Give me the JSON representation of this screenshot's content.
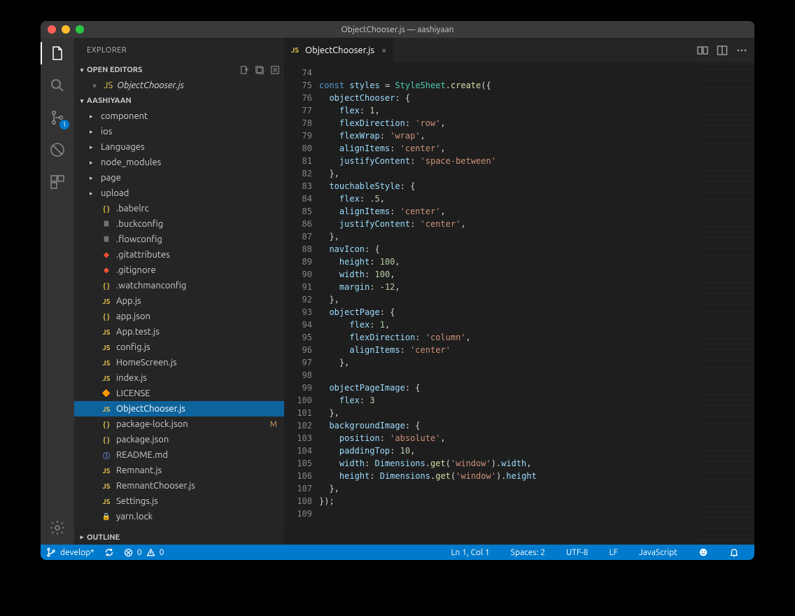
{
  "window": {
    "title": "ObjectChooser.js — aashiyaan"
  },
  "explorer": {
    "title": "EXPLORER",
    "openEditorsLabel": "OPEN EDITORS",
    "projectLabel": "AASHIYAAN",
    "outlineLabel": "OUTLINE",
    "openEditor": {
      "name": "ObjectChooser.js"
    },
    "scmBadge": "1",
    "tree": [
      {
        "name": "component",
        "kind": "folder"
      },
      {
        "name": "ios",
        "kind": "folder"
      },
      {
        "name": "Languages",
        "kind": "folder"
      },
      {
        "name": "node_modules",
        "kind": "folder"
      },
      {
        "name": "page",
        "kind": "folder"
      },
      {
        "name": "upload",
        "kind": "folder"
      },
      {
        "name": ".babelrc",
        "kind": "file",
        "icon": "json"
      },
      {
        "name": ".buckconfig",
        "kind": "file",
        "icon": "text"
      },
      {
        "name": ".flowconfig",
        "kind": "file",
        "icon": "text"
      },
      {
        "name": ".gitattributes",
        "kind": "file",
        "icon": "git"
      },
      {
        "name": ".gitignore",
        "kind": "file",
        "icon": "git"
      },
      {
        "name": ".watchmanconfig",
        "kind": "file",
        "icon": "json"
      },
      {
        "name": "App.js",
        "kind": "file",
        "icon": "js"
      },
      {
        "name": "app.json",
        "kind": "file",
        "icon": "json"
      },
      {
        "name": "App.test.js",
        "kind": "file",
        "icon": "js"
      },
      {
        "name": "config.js",
        "kind": "file",
        "icon": "js"
      },
      {
        "name": "HomeScreen.js",
        "kind": "file",
        "icon": "js"
      },
      {
        "name": "index.js",
        "kind": "file",
        "icon": "js"
      },
      {
        "name": "LICENSE",
        "kind": "file",
        "icon": "lic"
      },
      {
        "name": "ObjectChooser.js",
        "kind": "file",
        "icon": "js",
        "selected": true
      },
      {
        "name": "package-lock.json",
        "kind": "file",
        "icon": "json",
        "status": "M"
      },
      {
        "name": "package.json",
        "kind": "file",
        "icon": "json"
      },
      {
        "name": "README.md",
        "kind": "file",
        "icon": "info"
      },
      {
        "name": "Remnant.js",
        "kind": "file",
        "icon": "js"
      },
      {
        "name": "RemnantChooser.js",
        "kind": "file",
        "icon": "js"
      },
      {
        "name": "Settings.js",
        "kind": "file",
        "icon": "js"
      },
      {
        "name": "yarn.lock",
        "kind": "file",
        "icon": "lock"
      }
    ]
  },
  "tab": {
    "name": "ObjectChooser.js"
  },
  "code": {
    "startLine": 74,
    "lines": [
      {
        "n": 74,
        "html": ""
      },
      {
        "n": 75,
        "html": "<span class='kw'>const</span> <span class='id'>styles</span> <span class='op'>=</span> <span class='fn'>StyleSheet</span><span class='pn'>.</span><span class='mt'>create</span><span class='pn'>({</span>"
      },
      {
        "n": 76,
        "html": "  <span class='id'>objectChooser</span><span class='pn'>:</span> <span class='pn'>{</span>"
      },
      {
        "n": 77,
        "html": "    <span class='id'>flex</span><span class='pn'>:</span> <span class='nu'>1</span><span class='pn'>,</span>"
      },
      {
        "n": 78,
        "html": "    <span class='id'>flexDirection</span><span class='pn'>:</span> <span class='st'>'row'</span><span class='pn'>,</span>"
      },
      {
        "n": 79,
        "html": "    <span class='id'>flexWrap</span><span class='pn'>:</span> <span class='st'>'wrap'</span><span class='pn'>,</span>"
      },
      {
        "n": 80,
        "html": "    <span class='id'>alignItems</span><span class='pn'>:</span> <span class='st'>'center'</span><span class='pn'>,</span>"
      },
      {
        "n": 81,
        "html": "    <span class='id'>justifyContent</span><span class='pn'>:</span> <span class='st'>'space-between'</span>"
      },
      {
        "n": 82,
        "html": "  <span class='pn'>},</span>"
      },
      {
        "n": 83,
        "html": "  <span class='id'>touchableStyle</span><span class='pn'>:</span> <span class='pn'>{</span>"
      },
      {
        "n": 84,
        "html": "    <span class='id'>flex</span><span class='pn'>:</span> <span class='nu'>.5</span><span class='pn'>,</span>"
      },
      {
        "n": 85,
        "html": "    <span class='id'>alignItems</span><span class='pn'>:</span> <span class='st'>'center'</span><span class='pn'>,</span>"
      },
      {
        "n": 86,
        "html": "    <span class='id'>justifyContent</span><span class='pn'>:</span> <span class='st'>'center'</span><span class='pn'>,</span>"
      },
      {
        "n": 87,
        "html": "  <span class='pn'>},</span>"
      },
      {
        "n": 88,
        "html": "  <span class='id'>navIcon</span><span class='pn'>:</span> <span class='pn'>{</span>"
      },
      {
        "n": 89,
        "html": "    <span class='id'>height</span><span class='pn'>:</span> <span class='nu'>100</span><span class='pn'>,</span>"
      },
      {
        "n": 90,
        "html": "    <span class='id'>width</span><span class='pn'>:</span> <span class='nu'>100</span><span class='pn'>,</span>"
      },
      {
        "n": 91,
        "html": "    <span class='id'>margin</span><span class='pn'>:</span> <span class='nu'>-12</span><span class='pn'>,</span>"
      },
      {
        "n": 92,
        "html": "  <span class='pn'>},</span>"
      },
      {
        "n": 93,
        "html": "  <span class='id'>objectPage</span><span class='pn'>:</span> <span class='pn'>{</span>"
      },
      {
        "n": 94,
        "html": "      <span class='id'>flex</span><span class='pn'>:</span> <span class='nu'>1</span><span class='pn'>,</span>"
      },
      {
        "n": 95,
        "html": "      <span class='id'>flexDirection</span><span class='pn'>:</span> <span class='st'>'column'</span><span class='pn'>,</span>"
      },
      {
        "n": 96,
        "html": "      <span class='id'>alignItems</span><span class='pn'>:</span> <span class='st'>'center'</span>"
      },
      {
        "n": 97,
        "html": "    <span class='pn'>},</span>"
      },
      {
        "n": 98,
        "html": ""
      },
      {
        "n": 99,
        "html": "  <span class='id'>objectPageImage</span><span class='pn'>:</span> <span class='pn'>{</span>"
      },
      {
        "n": 100,
        "html": "    <span class='id'>flex</span><span class='pn'>:</span> <span class='nu'>3</span>"
      },
      {
        "n": 101,
        "html": "  <span class='pn'>},</span>"
      },
      {
        "n": 102,
        "html": "  <span class='id'>backgroundImage</span><span class='pn'>:</span> <span class='pn'>{</span>"
      },
      {
        "n": 103,
        "html": "    <span class='id'>position</span><span class='pn'>:</span> <span class='st'>'absolute'</span><span class='pn'>,</span>"
      },
      {
        "n": 104,
        "html": "    <span class='id'>paddingTop</span><span class='pn'>:</span> <span class='nu'>10</span><span class='pn'>,</span>"
      },
      {
        "n": 105,
        "html": "    <span class='id'>width</span><span class='pn'>:</span> <span class='id'>Dimensions</span><span class='pn'>.</span><span class='mt'>get</span><span class='pn'>(</span><span class='st'>'window'</span><span class='pn'>).</span><span class='id'>width</span><span class='pn'>,</span>"
      },
      {
        "n": 106,
        "html": "    <span class='id'>height</span><span class='pn'>:</span> <span class='id'>Dimensions</span><span class='pn'>.</span><span class='mt'>get</span><span class='pn'>(</span><span class='st'>'window'</span><span class='pn'>).</span><span class='id'>height</span>"
      },
      {
        "n": 107,
        "html": "  <span class='pn'>},</span>"
      },
      {
        "n": 108,
        "html": "<span class='pn'>});</span>"
      },
      {
        "n": 109,
        "html": ""
      }
    ]
  },
  "status": {
    "branch": "develop*",
    "errors": "0",
    "warnings": "0",
    "lncol": "Ln 1, Col 1",
    "spaces": "Spaces: 2",
    "encoding": "UTF-8",
    "eol": "LF",
    "language": "JavaScript"
  }
}
